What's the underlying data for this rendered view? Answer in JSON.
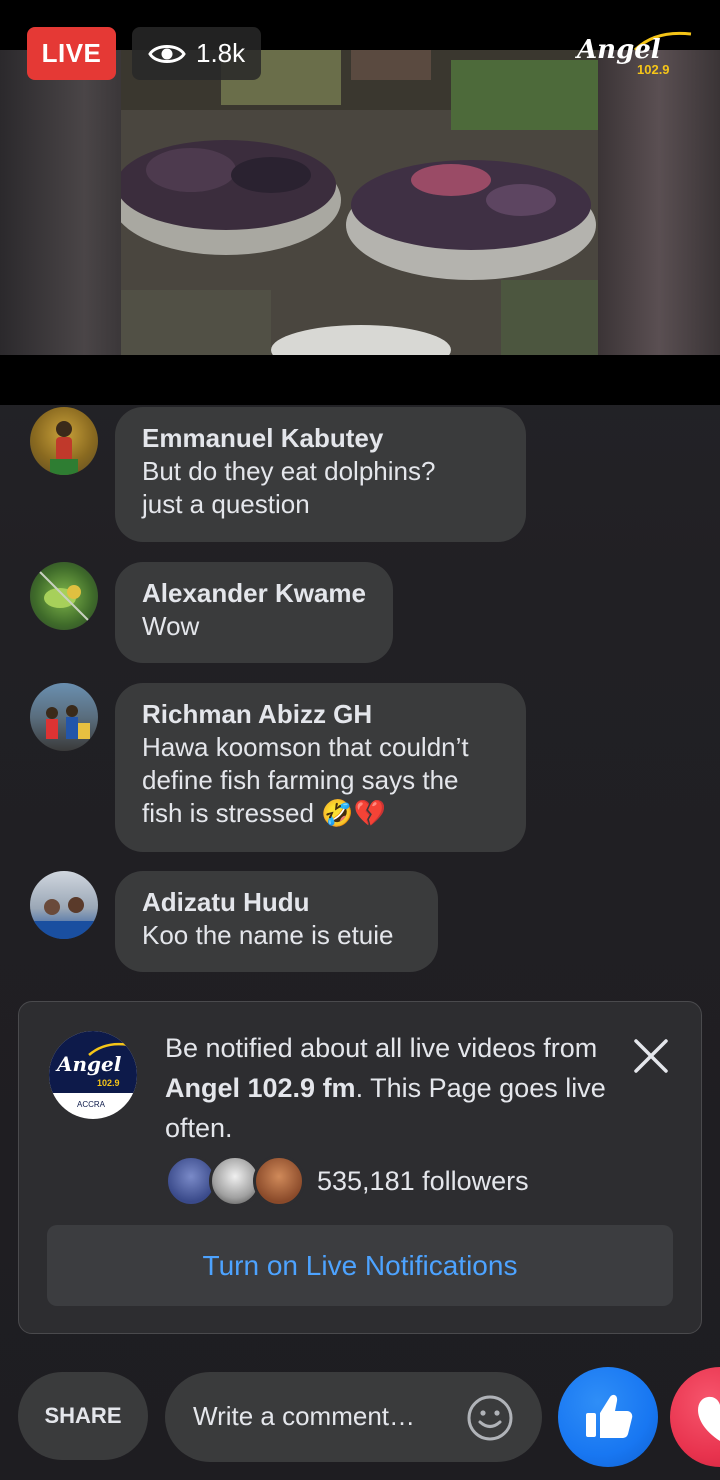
{
  "video": {
    "live_label": "LIVE",
    "viewer_count": "1.8k",
    "brand_name": "Angel",
    "brand_frequency": "102.9"
  },
  "comments": [
    {
      "author": "Emmanuel Kabutey",
      "lines": [
        "But do they eat dolphins?",
        "just a question"
      ]
    },
    {
      "author": "Alexander Kwame",
      "lines": [
        "Wow"
      ]
    },
    {
      "author": "Richman Abizz GH",
      "lines": [
        "Hawa koomson that couldn’t",
        "define fish farming says the",
        "fish is stressed 🤣💔"
      ]
    },
    {
      "author": "Adizatu Hudu",
      "lines": [
        "Koo the name is etuie"
      ]
    }
  ],
  "notification": {
    "text_before": "Be notified about all live videos from ",
    "page_name": "Angel 102.9 fm",
    "text_after": ". This Page goes live often.",
    "logo_text": "Angel",
    "logo_freq": "102.9",
    "logo_city": "ACCRA",
    "followers": "535,181 followers",
    "cta_label": "Turn on Live Notifications"
  },
  "bottom_bar": {
    "share_label": "SHARE",
    "comment_placeholder": "Write a comment…"
  },
  "colors": {
    "live_red": "#e53935",
    "link_blue": "#4da3ff",
    "like_blue": "#1877f2",
    "love_red": "#e8334e"
  },
  "icons": [
    "eye-icon",
    "close-icon",
    "emoji-icon",
    "thumbs-up-icon",
    "heart-icon"
  ]
}
